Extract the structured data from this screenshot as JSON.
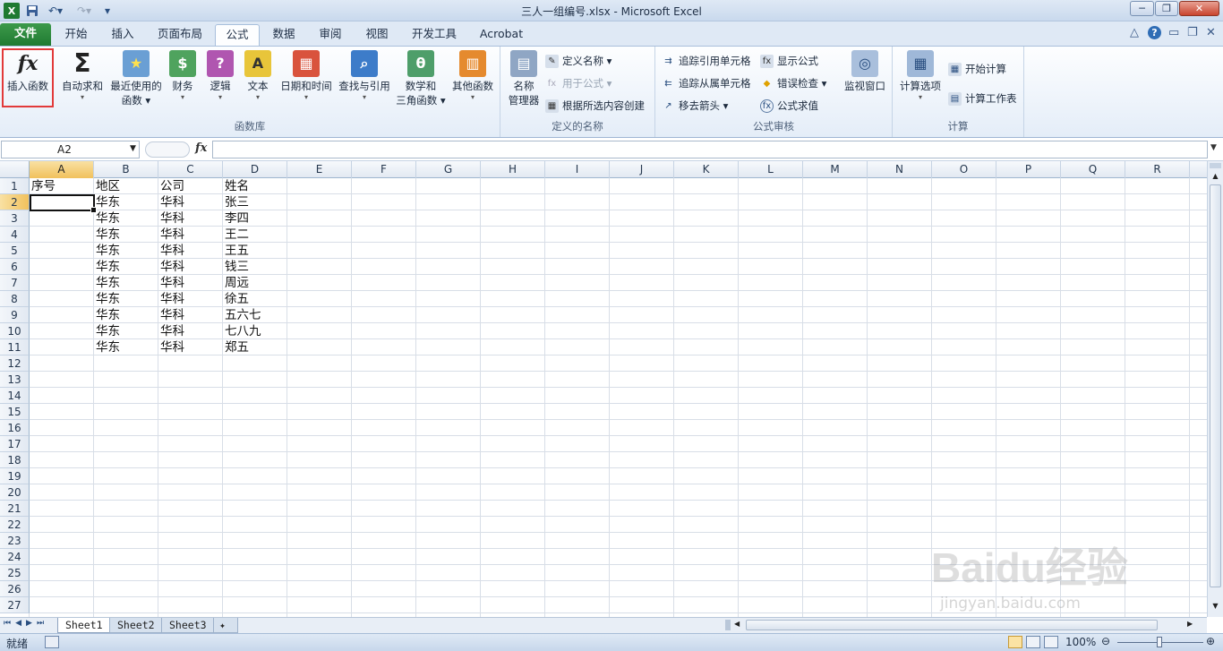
{
  "window": {
    "title": "三人一组编号.xlsx  -  Microsoft Excel"
  },
  "tabs": [
    {
      "label": "文件"
    },
    {
      "label": "开始"
    },
    {
      "label": "插入"
    },
    {
      "label": "页面布局"
    },
    {
      "label": "公式"
    },
    {
      "label": "数据"
    },
    {
      "label": "审阅"
    },
    {
      "label": "视图"
    },
    {
      "label": "开发工具"
    },
    {
      "label": "Acrobat"
    }
  ],
  "ribbon": {
    "function_library": {
      "label": "函数库",
      "insert_function": "插入函数",
      "autosum": "自动求和",
      "recent": [
        "最近使用的",
        "函数"
      ],
      "financial": "财务",
      "logical": "逻辑",
      "text": "文本",
      "datetime": "日期和时间",
      "lookup": "查找与引用",
      "math": [
        "数学和",
        "三角函数"
      ],
      "more": "其他函数"
    },
    "defined_names": {
      "label": "定义的名称",
      "name_manager": [
        "名称",
        "管理器"
      ],
      "define_name": "定义名称",
      "use_in_formula": "用于公式",
      "create_from_selection": "根据所选内容创建"
    },
    "formula_auditing": {
      "label": "公式审核",
      "trace_precedents": "追踪引用单元格",
      "trace_dependents": "追踪从属单元格",
      "remove_arrows": "移去箭头",
      "show_formulas": "显示公式",
      "error_checking": "错误检查",
      "evaluate_formula": "公式求值",
      "watch_window": "监视窗口"
    },
    "calculation": {
      "label": "计算",
      "options": "计算选项",
      "calc_now": "开始计算",
      "calc_sheet": "计算工作表"
    }
  },
  "formula_bar": {
    "name_box": "A2",
    "fx": "fx",
    "content": ""
  },
  "columns": [
    "A",
    "B",
    "C",
    "D",
    "E",
    "F",
    "G",
    "H",
    "I",
    "J",
    "K",
    "L",
    "M",
    "N",
    "O",
    "P",
    "Q",
    "R"
  ],
  "rows": [
    "1",
    "2",
    "3",
    "4",
    "5",
    "6",
    "7",
    "8",
    "9",
    "10",
    "11",
    "12",
    "13",
    "14",
    "15",
    "16",
    "17",
    "18",
    "19",
    "20",
    "21",
    "22",
    "23",
    "24",
    "25",
    "26",
    "27"
  ],
  "cells": [
    [
      "序号",
      "地区",
      "公司",
      "姓名"
    ],
    [
      "",
      "华东",
      "华科",
      "张三"
    ],
    [
      "",
      "华东",
      "华科",
      "李四"
    ],
    [
      "",
      "华东",
      "华科",
      "王二"
    ],
    [
      "",
      "华东",
      "华科",
      "王五"
    ],
    [
      "",
      "华东",
      "华科",
      "钱三"
    ],
    [
      "",
      "华东",
      "华科",
      "周远"
    ],
    [
      "",
      "华东",
      "华科",
      "徐五"
    ],
    [
      "",
      "华东",
      "华科",
      "五六七"
    ],
    [
      "",
      "华东",
      "华科",
      "七八九"
    ],
    [
      "",
      "华东",
      "华科",
      "郑五"
    ]
  ],
  "sheets": [
    {
      "name": "Sheet1",
      "active": true
    },
    {
      "name": "Sheet2",
      "active": false
    },
    {
      "name": "Sheet3",
      "active": false
    }
  ],
  "status": {
    "mode": "就绪",
    "zoom": "100%"
  },
  "watermark": {
    "text": "Baidu经验",
    "url": "jingyan.baidu.com"
  },
  "colors": {
    "file_tab": "#1f7a31",
    "highlight": "#e23a3a",
    "selected_header": "#f1c15c"
  }
}
